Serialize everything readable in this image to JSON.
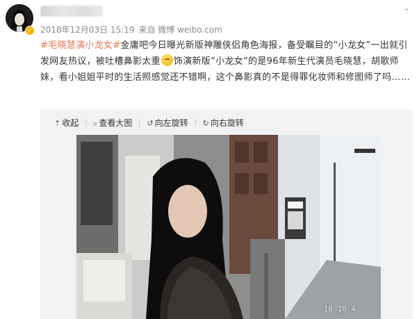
{
  "post": {
    "timestamp": "2018年12月03日 15:19",
    "source": "来自 微博 weibo.com",
    "hashtag": "#毛晓慧演小龙女#",
    "text_part1": "金庸吧今日曝光新版神雕侠侣角色海报，备受瞩目的“小龙女”一出就引发网友热议，被吐槽鼻影太重",
    "text_part2": "饰演新版“小龙女”的是96年新生代演员毛晓慧，胡歌师妹，看小姐姐平时的生活照感觉还不错啊，这个鼻影真的不是得罪化妆师和修图师了吗……"
  },
  "toolbar": {
    "collapse": "收起",
    "view_large": "查看大图",
    "rotate_left": "向左旋转",
    "rotate_right": "向右旋转"
  },
  "photo": {
    "stamp": "18 10  4"
  },
  "icons": {
    "verified": "verified-badge-icon",
    "emoji": "smirk-emoji-icon",
    "collapse": "collapse-arrow-icon",
    "zoom": "magnifier-icon",
    "rotate_left": "rotate-left-icon",
    "rotate_right": "rotate-right-icon",
    "menu": "chevron-down-icon"
  },
  "colors": {
    "hashtag": "#eb7350",
    "meta": "#8a8a8a",
    "panel_bg": "#f2f2f5"
  }
}
